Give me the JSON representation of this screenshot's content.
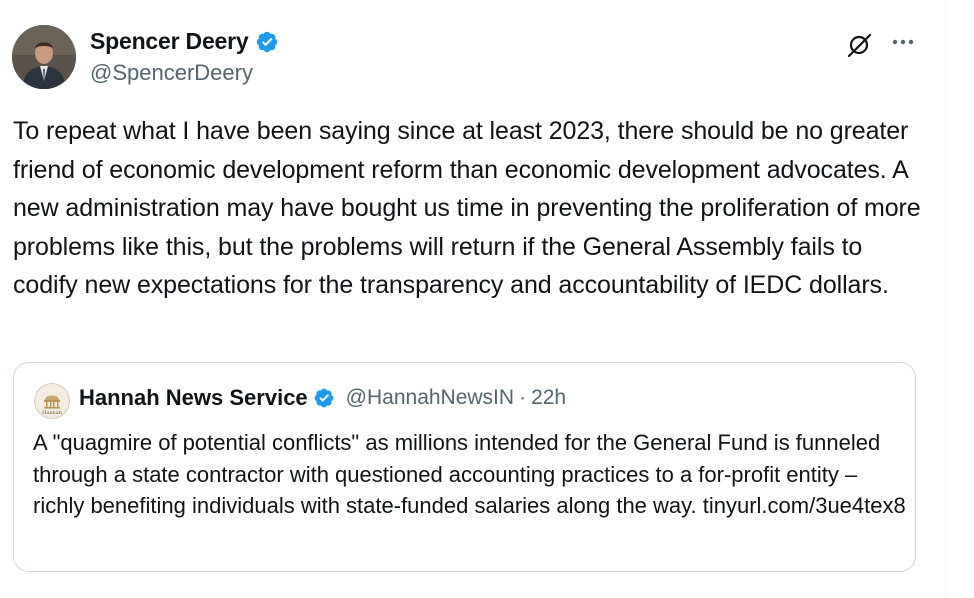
{
  "author": {
    "name": "Spencer Deery",
    "handle": "@SpencerDeery",
    "verified": true
  },
  "tweet": {
    "text": "To repeat what I have been saying since at least 2023, there should be no greater friend of economic development reform than economic development advocates. A new administration may have bought us time in preventing the proliferation of more problems like this, but the problems will return if the General Assembly fails to codify new expectations for the transparency and accountability of IEDC dollars."
  },
  "quote": {
    "name": "Hannah News Service",
    "handle": "@HannahNewsIN",
    "separator": "·",
    "time": "22h",
    "verified": true,
    "avatar_text": "Hannah",
    "text": "A \"quagmire of potential conflicts\" as millions intended for the General Fund is funneled through a state contractor with questioned accounting practices to a for-profit entity – richly benefiting individuals with state-funded salaries along the way. tinyurl.com/3ue4tex8"
  },
  "icons": {
    "grok": "grok-icon",
    "more": "more-options-icon",
    "verified": "verified-badge-icon"
  },
  "colors": {
    "verified": "#1d9bf0",
    "text_primary": "#0f1419",
    "text_secondary": "#536471",
    "border": "#cfd9de"
  }
}
